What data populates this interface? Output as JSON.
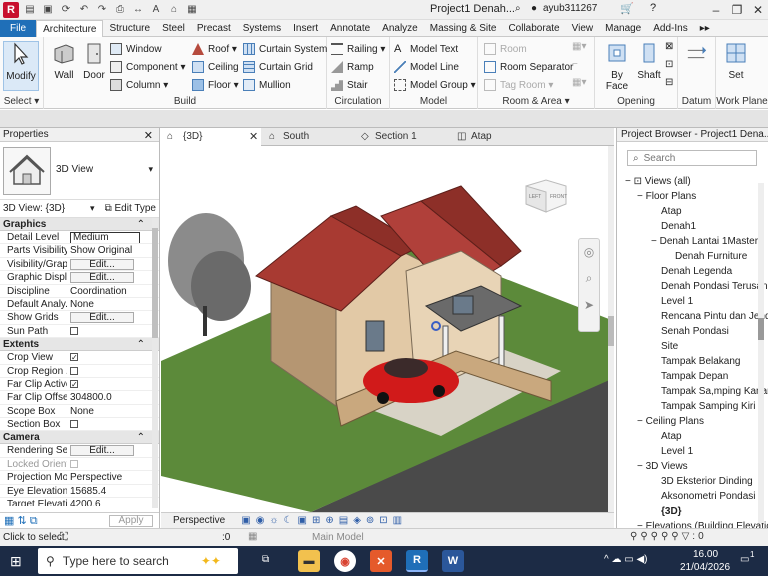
{
  "titlebar": {
    "title": "Project1 Denah...",
    "user": "ayub311267"
  },
  "ribbon_tabs": [
    "File",
    "Architecture",
    "Structure",
    "Steel",
    "Precast",
    "Systems",
    "Insert",
    "Annotate",
    "Analyze",
    "Massing & Site",
    "Collaborate",
    "View",
    "Manage",
    "Add-Ins"
  ],
  "ribbon": {
    "select": {
      "modify": "Modify",
      "label": "Select"
    },
    "build": {
      "wall": "Wall",
      "door": "Door",
      "window": "Window",
      "component": "Component",
      "column": "Column",
      "roof": "Roof",
      "ceiling": "Ceiling",
      "floor": "Floor",
      "curtain_system": "Curtain System",
      "curtain_grid": "Curtain Grid",
      "mullion": "Mullion",
      "label": "Build"
    },
    "circulation": {
      "railing": "Railing",
      "ramp": "Ramp",
      "stair": "Stair",
      "label": "Circulation"
    },
    "model": {
      "model_text": "Model Text",
      "model_line": "Model Line",
      "model_group": "Model Group",
      "label": "Model"
    },
    "room_area": {
      "room": "Room",
      "room_separator": "Room Separator",
      "tag_room": "Tag Room",
      "label": "Room & Area"
    },
    "opening": {
      "by_face": "By",
      "by_face2": "Face",
      "shaft": "Shaft",
      "label": "Opening"
    },
    "datum": {
      "label": "Datum"
    },
    "work_plane": {
      "set": "Set",
      "label": "Work Plane"
    }
  },
  "properties": {
    "title": "Properties",
    "type_name": "3D View",
    "instance": "3D View: {3D}",
    "edit_type": "Edit Type",
    "categories": {
      "graphics": "Graphics",
      "extents": "Extents",
      "camera": "Camera"
    },
    "graphics_rows": [
      {
        "name": "Detail Level",
        "value": "Medium",
        "kind": "box"
      },
      {
        "name": "Parts Visibility",
        "value": "Show Original",
        "kind": "text"
      },
      {
        "name": "Visibility/Grap...",
        "value": "Edit...",
        "kind": "btn"
      },
      {
        "name": "Graphic Displ...",
        "value": "Edit...",
        "kind": "btn"
      },
      {
        "name": "Discipline",
        "value": "Coordination",
        "kind": "text"
      },
      {
        "name": "Default Analy...",
        "value": "None",
        "kind": "text"
      },
      {
        "name": "Show Grids",
        "value": "Edit...",
        "kind": "btn"
      },
      {
        "name": "Sun Path",
        "value": "",
        "kind": "chk"
      }
    ],
    "extents_rows": [
      {
        "name": "Crop View",
        "value": "✓",
        "kind": "chk"
      },
      {
        "name": "Crop Region ...",
        "value": "",
        "kind": "chk"
      },
      {
        "name": "Far Clip Active",
        "value": "✓",
        "kind": "chk"
      },
      {
        "name": "Far Clip Offset",
        "value": "304800.0",
        "kind": "text"
      },
      {
        "name": "Scope Box",
        "value": "None",
        "kind": "text"
      },
      {
        "name": "Section Box",
        "value": "",
        "kind": "chk"
      }
    ],
    "camera_rows": [
      {
        "name": "Rendering Set...",
        "value": "Edit...",
        "kind": "btn"
      },
      {
        "name": "Locked Orient...",
        "value": "",
        "kind": "chkgrey"
      },
      {
        "name": "Projection Mo...",
        "value": "Perspective",
        "kind": "text"
      },
      {
        "name": "Eye Elevation",
        "value": "15685.4",
        "kind": "text"
      },
      {
        "name": "Target Elevation",
        "value": "4200.6",
        "kind": "text"
      }
    ],
    "apply": "Apply"
  },
  "view_tabs": [
    {
      "label": "{3D}",
      "active": true
    },
    {
      "label": "South",
      "active": false
    },
    {
      "label": "Section 1",
      "active": false
    },
    {
      "label": "Atap",
      "active": false
    }
  ],
  "view_controls": {
    "projection": "Perspective"
  },
  "viewcube": {
    "left": "LEFT",
    "front": "FRONT"
  },
  "project_browser": {
    "title": "Project Browser - Project1 Dena...",
    "search_placeholder": "Search",
    "root": "Views (all)",
    "floor_plans": "Floor Plans",
    "fp_items": [
      "Atap",
      "Denah1",
      "Denah Lantai 1Master"
    ],
    "fp_sub": "Denah Furniture",
    "fp_items2": [
      "Denah Legenda",
      "Denah Pondasi Terusan",
      "Level 1",
      "Rencana Pintu dan Jend",
      "Senah Pondasi",
      "Site",
      "Tampak Belakang",
      "Tampak Depan",
      "Tampak Sa,mping Kanan",
      "Tampak Samping Kiri"
    ],
    "ceiling_plans": "Ceiling Plans",
    "cp_items": [
      "Atap",
      "Level 1"
    ],
    "views_3d": "3D Views",
    "v3d_items": [
      "3D Eksterior Dinding",
      "Aksonometri Pondasi",
      "{3D}"
    ],
    "elevations": "Elevations (Building Elevation)"
  },
  "statusbar": {
    "hint": "Click to select",
    "count": ":0",
    "model": "Main Model"
  },
  "taskbar": {
    "search": "Type here to search",
    "time": "16.00",
    "date": "21/04/2026",
    "notif": "1"
  },
  "colors": {
    "file_tab": "#1f6fb8",
    "roof": "#a83a32",
    "car": "#d11a1a",
    "grass": "#5c8a3a",
    "road": "#4a4a4a",
    "taskbar": "#1c2b45"
  }
}
